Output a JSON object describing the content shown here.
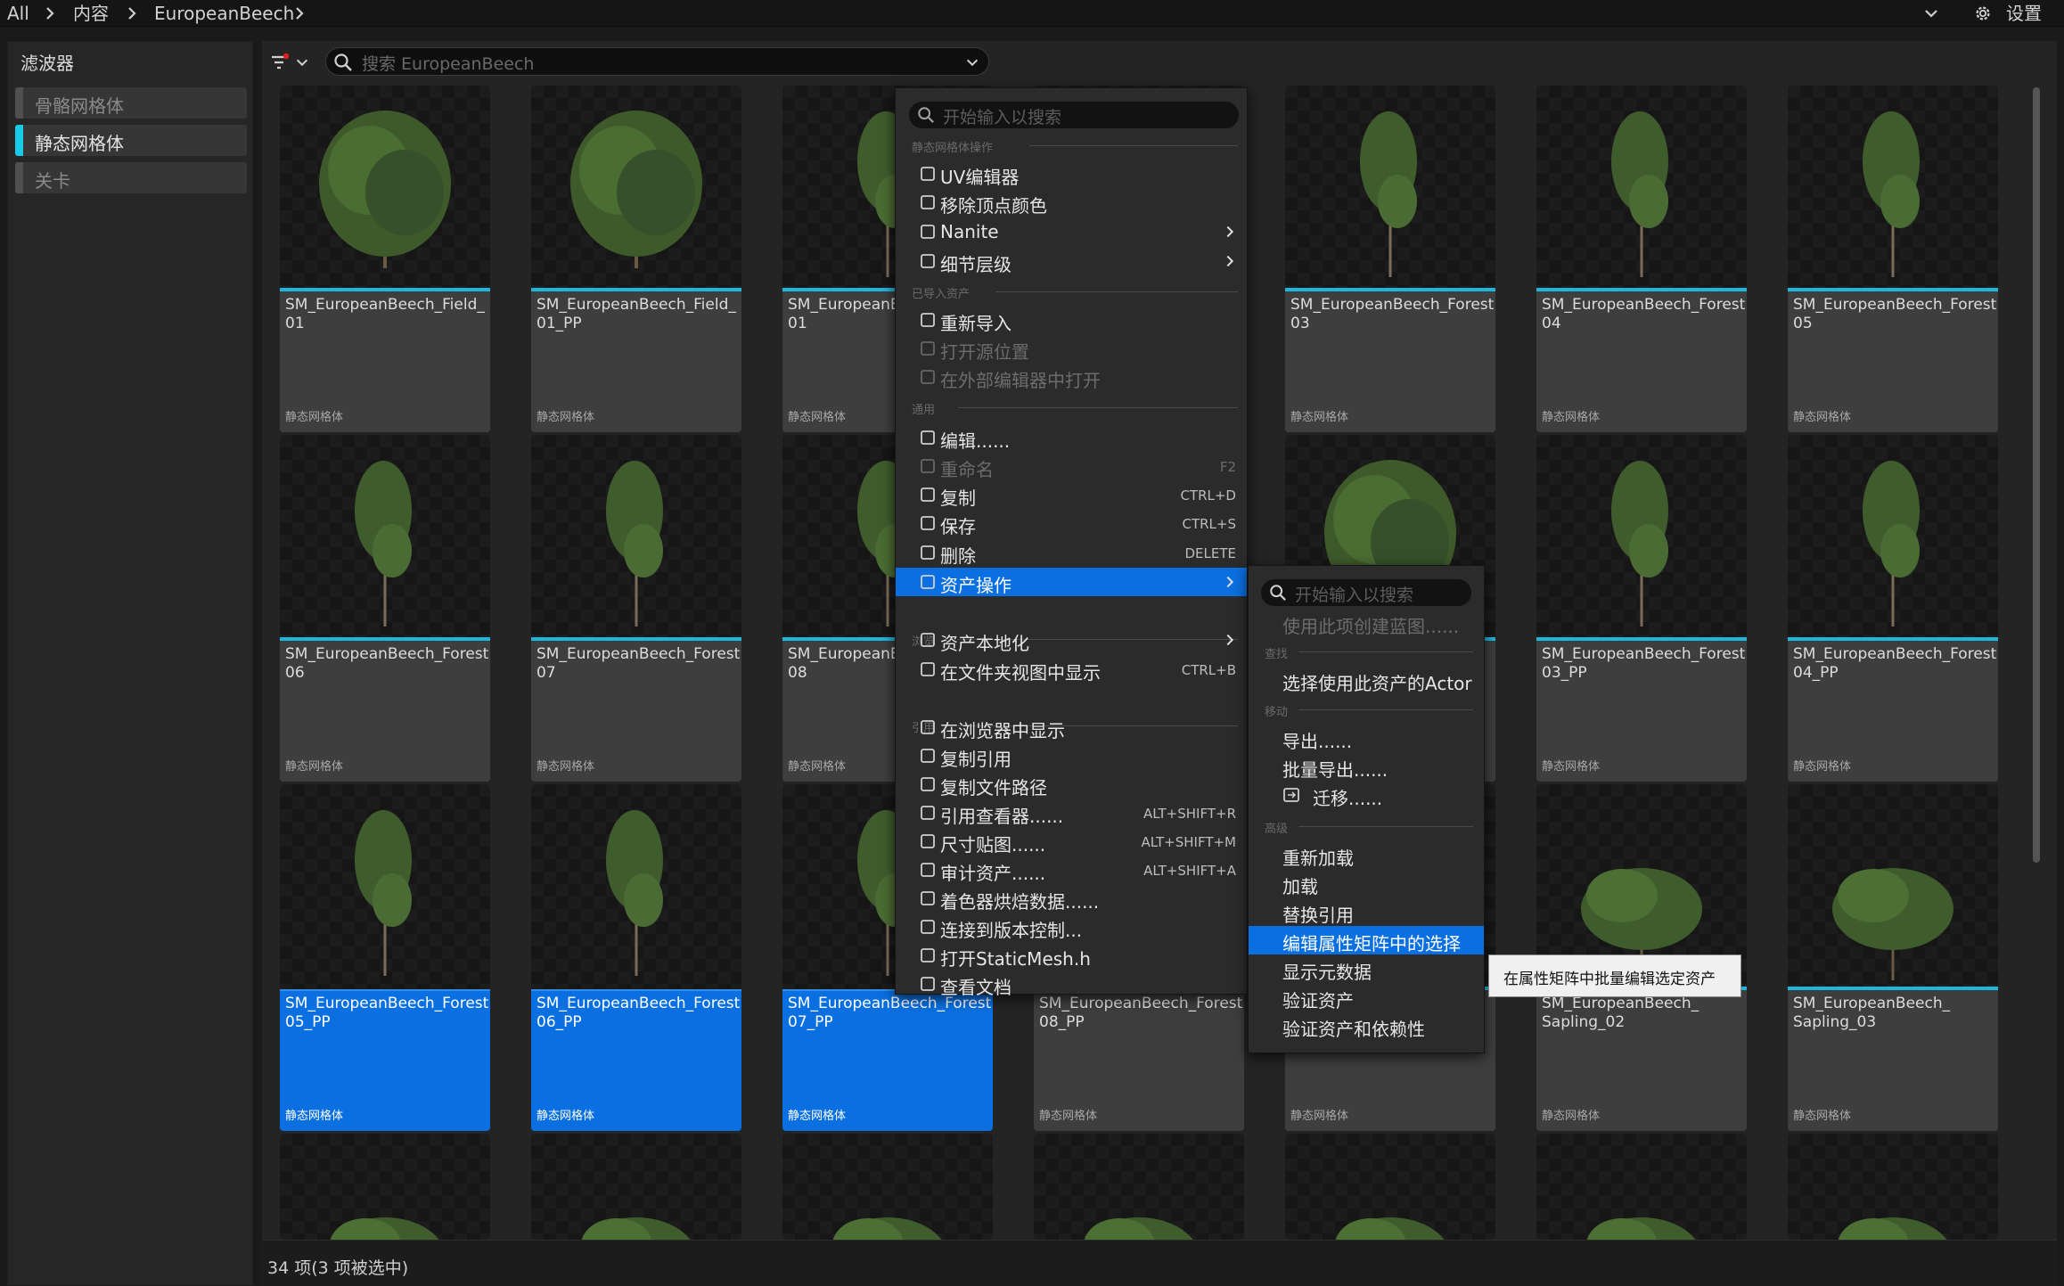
{
  "breadcrumb": {
    "all": "All",
    "content": "内容",
    "folder": "EuropeanBeech"
  },
  "settings_label": "设置",
  "filters": {
    "title": "滤波器",
    "items": [
      {
        "label": "骨骼网格体"
      },
      {
        "label": "静态网格体"
      },
      {
        "label": "关卡"
      }
    ]
  },
  "search": {
    "placeholder": "搜索 EuropeanBeech"
  },
  "assets": [
    {
      "name": "SM_EuropeanBeech_Field_\n01",
      "type": "静态网格体"
    },
    {
      "name": "SM_EuropeanBeech_Field_\n01_PP",
      "type": "静态网格体"
    },
    {
      "name": "SM_EuropeanBeech_Forest_\n01",
      "type": "静态网格体"
    },
    {
      "name": "",
      "type": ""
    },
    {
      "name": "SM_EuropeanBeech_Forest_\n03",
      "type": "静态网格体"
    },
    {
      "name": "SM_EuropeanBeech_Forest_\n04",
      "type": "静态网格体"
    },
    {
      "name": "SM_EuropeanBeech_Forest_\n05",
      "type": "静态网格体"
    },
    {
      "name": "SM_EuropeanBeech_Forest_\n06",
      "type": "静态网格体"
    },
    {
      "name": "SM_EuropeanBeech_Forest_\n07",
      "type": "静态网格体"
    },
    {
      "name": "SM_EuropeanBeech_Forest_\n08",
      "type": "静态网格体"
    },
    {
      "name": "",
      "type": ""
    },
    {
      "name": "",
      "type": ""
    },
    {
      "name": "SM_EuropeanBeech_Forest_\n03_PP",
      "type": "静态网格体"
    },
    {
      "name": "SM_EuropeanBeech_Forest_\n04_PP",
      "type": "静态网格体"
    },
    {
      "name": "SM_EuropeanBeech_Forest_\n05_PP",
      "type": "静态网格体"
    },
    {
      "name": "SM_EuropeanBeech_Forest_\n06_PP",
      "type": "静态网格体"
    },
    {
      "name": "SM_EuropeanBeech_Forest_\n07_PP",
      "type": "静态网格体"
    },
    {
      "name": "SM_EuropeanBeech_Forest_\n08_PP",
      "type": "静态网格体"
    },
    {
      "name": "",
      "type": "静态网格体"
    },
    {
      "name": "SM_EuropeanBeech_\nSapling_02",
      "type": "静态网格体"
    },
    {
      "name": "SM_EuropeanBeech_\nSapling_03",
      "type": "静态网格体"
    }
  ],
  "status": {
    "text": "34 项(3 项被选中)"
  },
  "context_menu": {
    "search_placeholder": "开始输入以搜索",
    "sections": {
      "mesh_ops": "静态网格体操作",
      "imported": "已导入资产",
      "common": "通用",
      "browse": "浏览",
      "references": "引用"
    },
    "items": [
      {
        "label": "UV编辑器",
        "shortcut": ""
      },
      {
        "label": "移除顶点颜色",
        "shortcut": ""
      },
      {
        "label": "Nanite",
        "shortcut": ""
      },
      {
        "label": "细节层级",
        "shortcut": ""
      },
      {
        "label": "重新导入",
        "shortcut": ""
      },
      {
        "label": "打开源位置",
        "shortcut": ""
      },
      {
        "label": "在外部编辑器中打开",
        "shortcut": ""
      },
      {
        "label": "编辑......",
        "shortcut": ""
      },
      {
        "label": "重命名",
        "shortcut": "F2"
      },
      {
        "label": "复制",
        "shortcut": "CTRL+D"
      },
      {
        "label": "保存",
        "shortcut": "CTRL+S"
      },
      {
        "label": "删除",
        "shortcut": "DELETE"
      },
      {
        "label": "资产操作",
        "shortcut": ""
      },
      {
        "label": "资产本地化",
        "shortcut": ""
      },
      {
        "label": "在文件夹视图中显示",
        "shortcut": "CTRL+B"
      },
      {
        "label": "在浏览器中显示",
        "shortcut": ""
      },
      {
        "label": "复制引用",
        "shortcut": ""
      },
      {
        "label": "复制文件路径",
        "shortcut": ""
      },
      {
        "label": "引用查看器......",
        "shortcut": "ALT+SHIFT+R"
      },
      {
        "label": "尺寸贴图......",
        "shortcut": "ALT+SHIFT+M"
      },
      {
        "label": "审计资产......",
        "shortcut": "ALT+SHIFT+A"
      },
      {
        "label": "着色器烘焙数据......",
        "shortcut": ""
      },
      {
        "label": "连接到版本控制...",
        "shortcut": ""
      },
      {
        "label": "打开StaticMesh.h",
        "shortcut": ""
      },
      {
        "label": "查看文档",
        "shortcut": ""
      }
    ]
  },
  "submenu": {
    "search_placeholder": "开始输入以搜索",
    "sections": {
      "find": "查找",
      "move": "移动",
      "advanced": "高级"
    },
    "items": [
      {
        "label": "使用此项创建蓝图......"
      },
      {
        "label": "选择使用此资产的Actor"
      },
      {
        "label": "导出......"
      },
      {
        "label": "批量导出......"
      },
      {
        "label": "迁移......"
      },
      {
        "label": "重新加载"
      },
      {
        "label": "加载"
      },
      {
        "label": "替换引用"
      },
      {
        "label": "编辑属性矩阵中的选择"
      },
      {
        "label": "显示元数据"
      },
      {
        "label": "验证资产"
      },
      {
        "label": "验证资产和依赖性"
      }
    ]
  },
  "tooltip": {
    "text": "在属性矩阵中批量编辑选定资产"
  },
  "colors": {
    "accent": "#0a6fe0",
    "asset_underline": "#1fb6dd",
    "filter_active": "#19c9e8"
  }
}
